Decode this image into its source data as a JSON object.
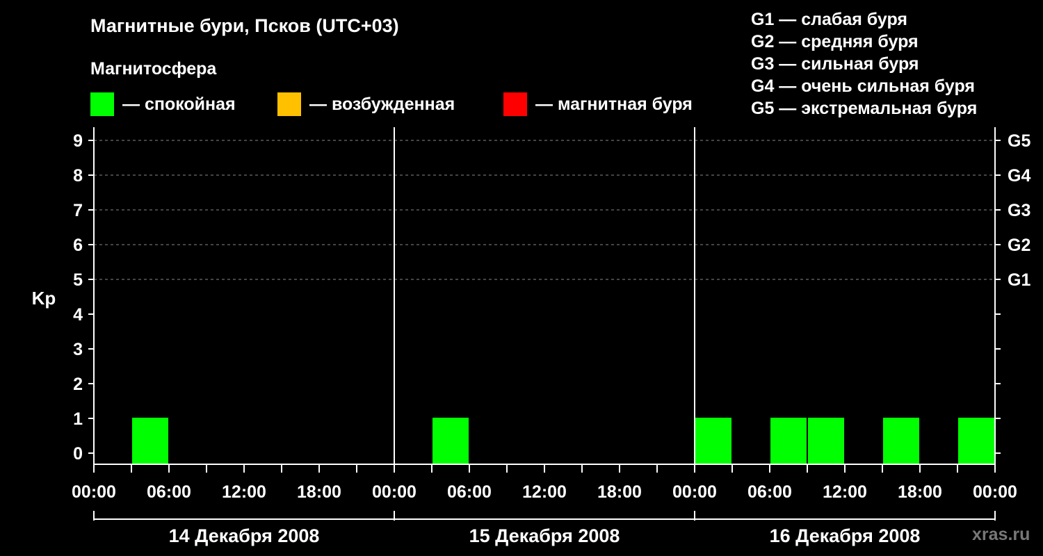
{
  "title": "Магнитные бури, Псков (UTC+03)",
  "subtitle": "Магнитосфера",
  "legend": [
    {
      "color": "#00ff00",
      "label": "— спокойная"
    },
    {
      "color": "#ffc000",
      "label": "— возбужденная"
    },
    {
      "color": "#ff0000",
      "label": "— магнитная буря"
    }
  ],
  "storm_levels": [
    "G1 — слабая буря",
    "G2 — средняя буря",
    "G3 — сильная буря",
    "G4 — очень сильная буря",
    "G5 — экстремальная буря"
  ],
  "watermark": "xras.ru",
  "chart_data": {
    "type": "bar",
    "title": "Магнитные бури, Псков (UTC+03)",
    "ylabel": "Kp",
    "ylim": [
      0,
      9
    ],
    "yticks": [
      "0",
      "1",
      "2",
      "3",
      "4",
      "5",
      "6",
      "7",
      "8",
      "9"
    ],
    "right_ticks": [
      {
        "kp": 5,
        "label": "G1"
      },
      {
        "kp": 6,
        "label": "G2"
      },
      {
        "kp": 7,
        "label": "G3"
      },
      {
        "kp": 8,
        "label": "G4"
      },
      {
        "kp": 9,
        "label": "G5"
      }
    ],
    "xticks": [
      "00:00",
      "06:00",
      "12:00",
      "18:00",
      "00:00",
      "06:00",
      "12:00",
      "18:00",
      "00:00",
      "06:00",
      "12:00",
      "18:00",
      "00:00"
    ],
    "days": [
      "14 Декабря 2008",
      "15 Декабря 2008",
      "16 Декабря 2008"
    ],
    "grid": "dashed horizontal at Kp 5–9",
    "series": [
      {
        "values": [
          {
            "day": "14 Декабря 2008",
            "start": "03:00",
            "end": "06:00",
            "kp": 1,
            "color": "#00ff00"
          },
          {
            "day": "15 Декабря 2008",
            "start": "03:00",
            "end": "06:00",
            "kp": 1,
            "color": "#00ff00"
          },
          {
            "day": "16 Декабря 2008",
            "start": "00:00",
            "end": "03:00",
            "kp": 1,
            "color": "#00ff00"
          },
          {
            "day": "16 Декабря 2008",
            "start": "06:00",
            "end": "09:00",
            "kp": 1,
            "color": "#00ff00"
          },
          {
            "day": "16 Декабря 2008",
            "start": "09:00",
            "end": "12:00",
            "kp": 1,
            "color": "#00ff00"
          },
          {
            "day": "16 Декабря 2008",
            "start": "15:00",
            "end": "18:00",
            "kp": 1,
            "color": "#00ff00"
          },
          {
            "day": "16 Декабря 2008",
            "start": "21:00",
            "end": "24:00",
            "kp": 1,
            "color": "#00ff00"
          }
        ]
      }
    ]
  }
}
